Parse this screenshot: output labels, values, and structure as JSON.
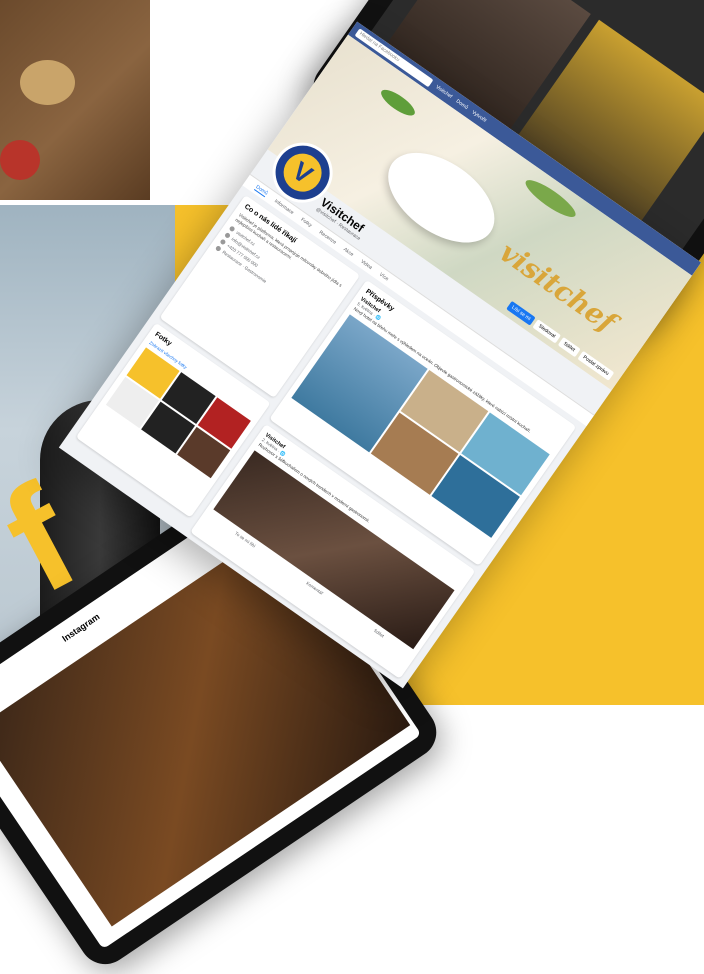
{
  "page": {
    "name": "Visitchef",
    "cover_script": "visitchef",
    "profile_letter": "V",
    "handle": "@visitchef · Restaurace",
    "search_placeholder": "Hledat na Facebooku",
    "topbar_links": [
      "Visitchef",
      "Domů",
      "Vytvořit"
    ],
    "tabs": [
      "Domů",
      "Informace",
      "Fotky",
      "Recenze",
      "Akce",
      "Videa",
      "Více"
    ],
    "cover_buttons": [
      "Líbí se mi",
      "Sledovat",
      "Sdílet",
      "Poslat zprávu"
    ],
    "fb_letter": "f"
  },
  "about": {
    "title": "Co o nás lidé říkají",
    "text": "Visitchef je platforma, která propojuje milovníky dobrého jídla s nejlepšími kuchaři a restauracemi.",
    "rows": [
      "visitchef.cz",
      "info@visitchef.cz",
      "+420 777 000 000",
      "Restaurace · Gastronomie"
    ]
  },
  "photos": {
    "title": "Fotky",
    "link": "Zobrazit všechny fotky"
  },
  "post1": {
    "title": "Příspěvky",
    "author": "Visitchef",
    "meta": "5. května · 🌐",
    "text": "Nový hotel na břehu moře s výhledem na oceán. Objevte gastronomické zážitky, které nabízí místní kuchaři."
  },
  "post2": {
    "author": "Visitchef",
    "meta": "2. května · 🌐",
    "text": "Rozhovor s šéfkuchařem o nových trendech v moderní gastronomii.",
    "actions": [
      "To se mi líbí",
      "Komentář",
      "Sdílet"
    ]
  },
  "tablet_bottom": {
    "title": "Instagram"
  },
  "colors": {
    "brand_yellow": "#f6c12b",
    "fb_blue": "#3b5998",
    "logo_blue": "#1d3f8f",
    "accent": "#1877f2"
  }
}
